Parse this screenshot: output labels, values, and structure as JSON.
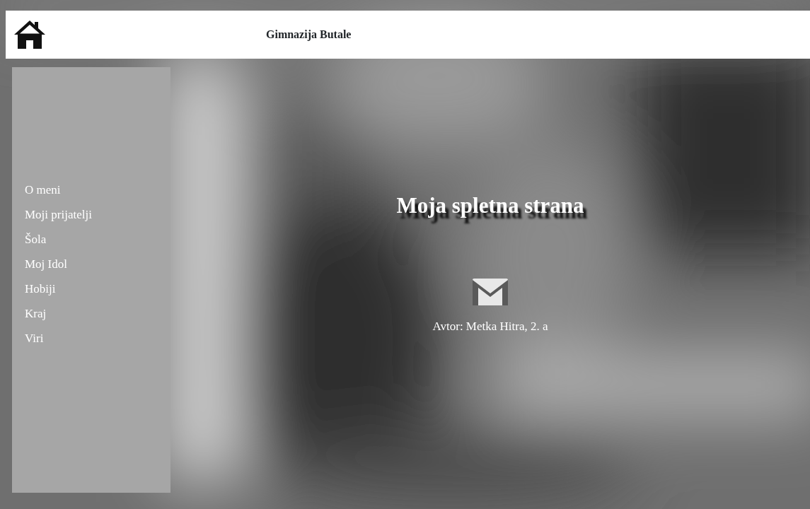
{
  "header": {
    "title": "Gimnazija Butale"
  },
  "sidebar": {
    "items": [
      {
        "label": "O meni"
      },
      {
        "label": "Moji prijatelji"
      },
      {
        "label": "Šola"
      },
      {
        "label": "Moj Idol"
      },
      {
        "label": "Hobiji"
      },
      {
        "label": "Kraj"
      },
      {
        "label": "Viri"
      }
    ]
  },
  "main": {
    "heading": "Moja spletna strana",
    "author": "Avtor: Metka Hitra, 2. a"
  }
}
